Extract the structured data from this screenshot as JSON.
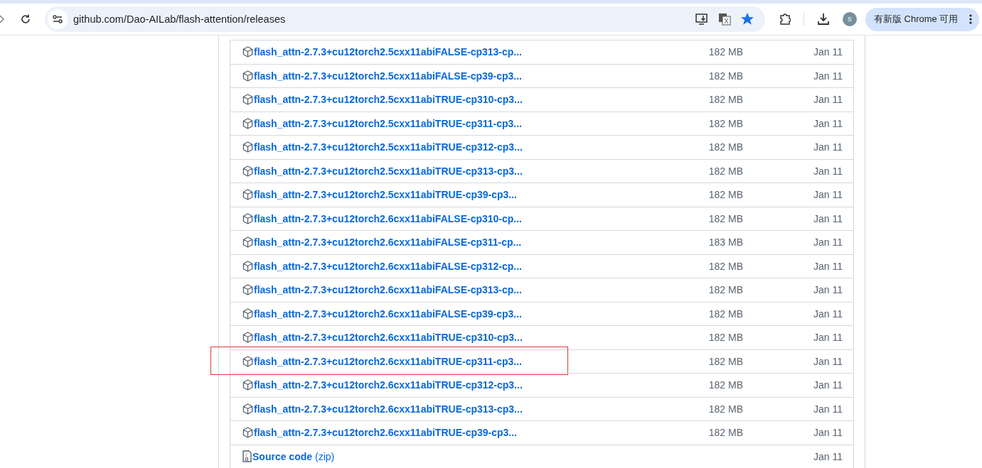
{
  "browser": {
    "url": "github.com/Dao-AILab/flash-attention/releases",
    "update_button": "有新版 Chrome 可用",
    "profile_initial": "S",
    "bookmarked": true
  },
  "assets": [
    {
      "kind": "package",
      "name": "flash_attn-2.7.3+cu12torch2.5cxx11abiFALSE-cp313-cp...",
      "size": "182 MB",
      "date": "Jan 11",
      "highlighted": false
    },
    {
      "kind": "package",
      "name": "flash_attn-2.7.3+cu12torch2.5cxx11abiFALSE-cp39-cp3...",
      "size": "182 MB",
      "date": "Jan 11",
      "highlighted": false
    },
    {
      "kind": "package",
      "name": "flash_attn-2.7.3+cu12torch2.5cxx11abiTRUE-cp310-cp3...",
      "size": "182 MB",
      "date": "Jan 11",
      "highlighted": false
    },
    {
      "kind": "package",
      "name": "flash_attn-2.7.3+cu12torch2.5cxx11abiTRUE-cp311-cp3...",
      "size": "182 MB",
      "date": "Jan 11",
      "highlighted": false
    },
    {
      "kind": "package",
      "name": "flash_attn-2.7.3+cu12torch2.5cxx11abiTRUE-cp312-cp3...",
      "size": "182 MB",
      "date": "Jan 11",
      "highlighted": false
    },
    {
      "kind": "package",
      "name": "flash_attn-2.7.3+cu12torch2.5cxx11abiTRUE-cp313-cp3...",
      "size": "182 MB",
      "date": "Jan 11",
      "highlighted": false
    },
    {
      "kind": "package",
      "name": "flash_attn-2.7.3+cu12torch2.5cxx11abiTRUE-cp39-cp3...",
      "size": "182 MB",
      "date": "Jan 11",
      "highlighted": false
    },
    {
      "kind": "package",
      "name": "flash_attn-2.7.3+cu12torch2.6cxx11abiFALSE-cp310-cp...",
      "size": "182 MB",
      "date": "Jan 11",
      "highlighted": false
    },
    {
      "kind": "package",
      "name": "flash_attn-2.7.3+cu12torch2.6cxx11abiFALSE-cp311-cp...",
      "size": "183 MB",
      "date": "Jan 11",
      "highlighted": false
    },
    {
      "kind": "package",
      "name": "flash_attn-2.7.3+cu12torch2.6cxx11abiFALSE-cp312-cp...",
      "size": "182 MB",
      "date": "Jan 11",
      "highlighted": false
    },
    {
      "kind": "package",
      "name": "flash_attn-2.7.3+cu12torch2.6cxx11abiFALSE-cp313-cp...",
      "size": "182 MB",
      "date": "Jan 11",
      "highlighted": false
    },
    {
      "kind": "package",
      "name": "flash_attn-2.7.3+cu12torch2.6cxx11abiFALSE-cp39-cp3...",
      "size": "182 MB",
      "date": "Jan 11",
      "highlighted": false
    },
    {
      "kind": "package",
      "name": "flash_attn-2.7.3+cu12torch2.6cxx11abiTRUE-cp310-cp3...",
      "size": "182 MB",
      "date": "Jan 11",
      "highlighted": false
    },
    {
      "kind": "package",
      "name": "flash_attn-2.7.3+cu12torch2.6cxx11abiTRUE-cp311-cp3...",
      "size": "182 MB",
      "date": "Jan 11",
      "highlighted": true
    },
    {
      "kind": "package",
      "name": "flash_attn-2.7.3+cu12torch2.6cxx11abiTRUE-cp312-cp3...",
      "size": "182 MB",
      "date": "Jan 11",
      "highlighted": false
    },
    {
      "kind": "package",
      "name": "flash_attn-2.7.3+cu12torch2.6cxx11abiTRUE-cp313-cp3...",
      "size": "182 MB",
      "date": "Jan 11",
      "highlighted": false
    },
    {
      "kind": "package",
      "name": "flash_attn-2.7.3+cu12torch2.6cxx11abiTRUE-cp39-cp3...",
      "size": "182 MB",
      "date": "Jan 11",
      "highlighted": false
    },
    {
      "kind": "source",
      "name": "Source code",
      "format": "(zip)",
      "date": "Jan 11",
      "highlighted": false
    }
  ]
}
